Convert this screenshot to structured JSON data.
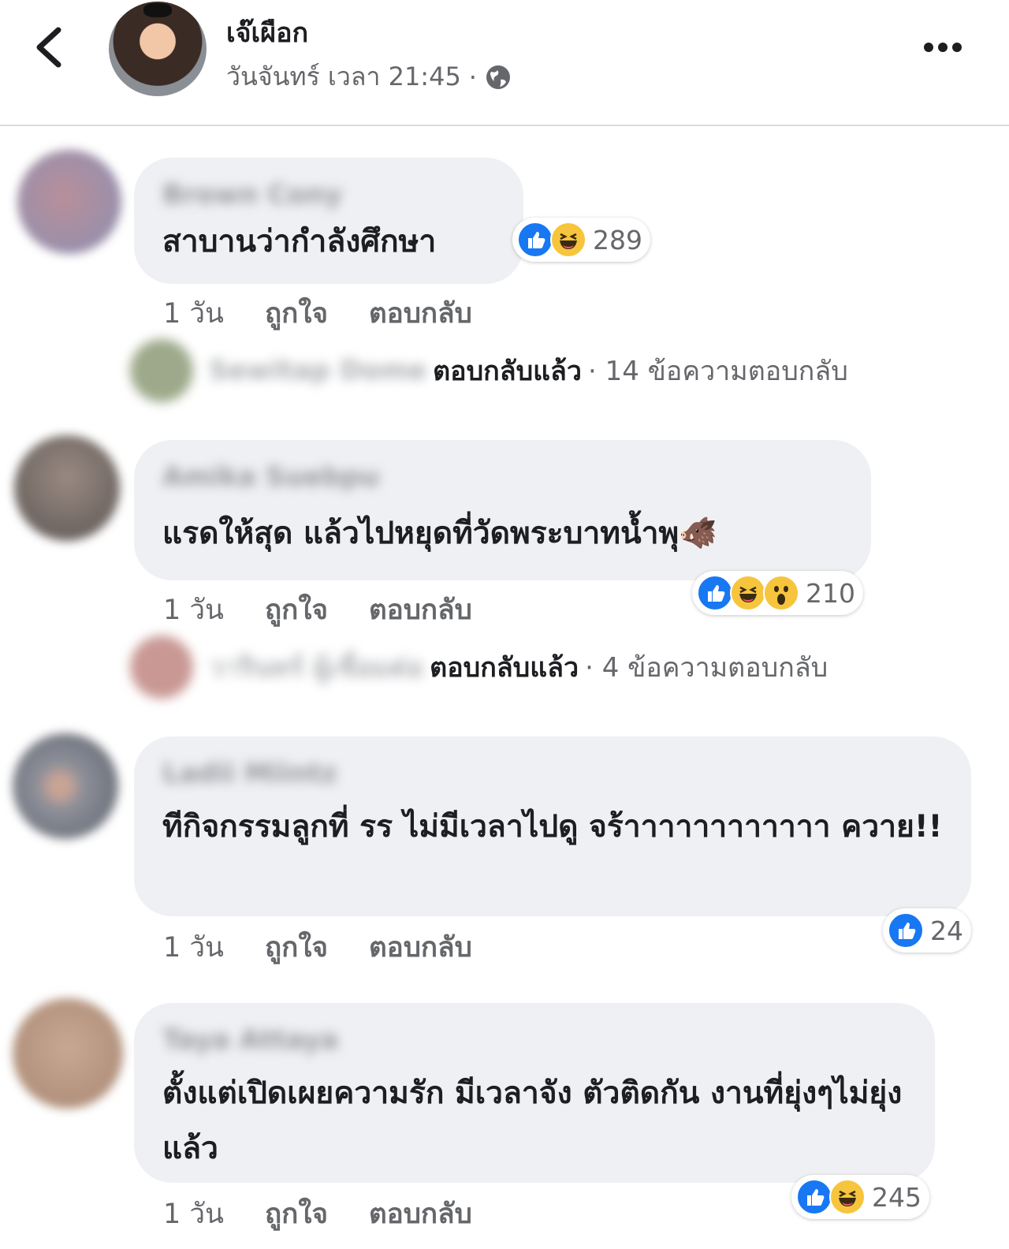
{
  "header": {
    "page_name": "เจ๊เผือก",
    "post_time": "วันจันทร์ เวลา 21:45",
    "separator": "·"
  },
  "colors": {
    "like_blue": "#1877f2",
    "haha_yellow": "#f7c53d",
    "bubble_gray": "#eff0f3"
  },
  "comments": [
    {
      "author": "Brown Cony",
      "text": "สาบานว่ากำลังศึกษา",
      "time": "1 วัน",
      "like_label": "ถูกใจ",
      "reply_label": "ตอบกลับ",
      "reactions": [
        "like",
        "haha"
      ],
      "reaction_count": "289",
      "reply_summary": {
        "name": "Sewitap Dome",
        "replied": "ตอบกลับแล้ว",
        "count": "· 14 ข้อความตอบกลับ"
      }
    },
    {
      "author": "Amika Suebpu",
      "text": "แรดให้สุด แล้วไปหยุดที่วัดพระบาทน้ำพุ🐗",
      "time": "1 วัน",
      "like_label": "ถูกใจ",
      "reply_label": "ตอบกลับ",
      "reactions": [
        "like",
        "haha",
        "wow"
      ],
      "reaction_count": "210",
      "reply_summary": {
        "name": "วารินทร์ ผู้เชื่อมต่อ",
        "replied": "ตอบกลับแล้ว",
        "count": "· 4 ข้อความตอบกลับ"
      }
    },
    {
      "author": "Ladii Miintz",
      "text": "ทีกิจกรรมลูกที่ รร ไม่มีเวลาไปดู จร้าาาาาาาาาาาา ควาย!!",
      "time": "1 วัน",
      "like_label": "ถูกใจ",
      "reply_label": "ตอบกลับ",
      "reactions": [
        "like"
      ],
      "reaction_count": "24"
    },
    {
      "author": "Taya Attaya",
      "text": "ตั้งแต่เปิดเผยความรัก มีเวลาจัง ตัวติดกัน งานที่ยุ่งๆไม่ยุ่งแล้ว",
      "time": "1 วัน",
      "like_label": "ถูกใจ",
      "reply_label": "ตอบกลับ",
      "reactions": [
        "like",
        "haha"
      ],
      "reaction_count": "245"
    }
  ]
}
